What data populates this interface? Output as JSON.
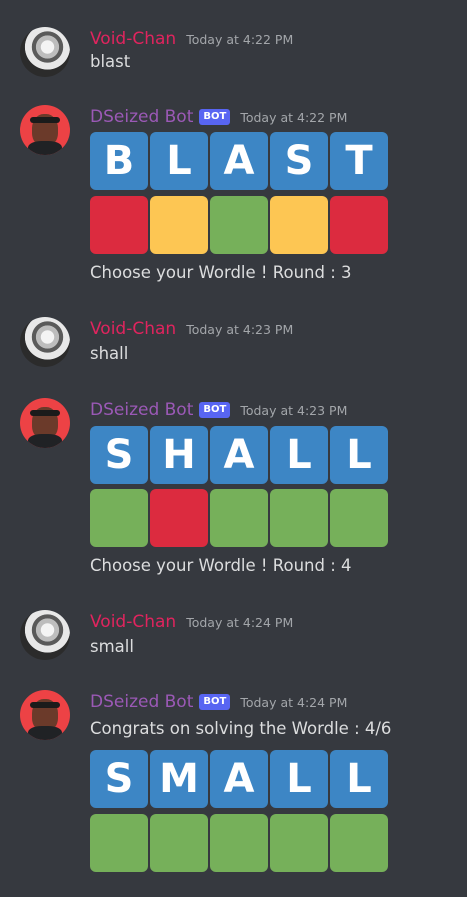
{
  "colors": {
    "letter_tile": "#3d86c5",
    "red": "#dc2b3f",
    "yellow": "#fdc653",
    "green": "#76b05a",
    "user_name": "#e0245e",
    "bot_name": "#9b59b6",
    "bot_tag": "#5865f2",
    "background": "#36393f"
  },
  "messages": [
    {
      "author": "Void-Chan",
      "is_bot": false,
      "time": "Today at 4:22 PM",
      "text": "blast"
    },
    {
      "author": "DSeized Bot",
      "is_bot": true,
      "bot_tag": "BOT",
      "time": "Today at 4:22 PM",
      "letters": [
        "B",
        "L",
        "A",
        "S",
        "T"
      ],
      "result": [
        "red",
        "yellow",
        "green",
        "yellow",
        "red"
      ],
      "text": "Choose your Wordle ! Round : 3"
    },
    {
      "author": "Void-Chan",
      "is_bot": false,
      "time": "Today at 4:23 PM",
      "text": "shall"
    },
    {
      "author": "DSeized Bot",
      "is_bot": true,
      "bot_tag": "BOT",
      "time": "Today at 4:23 PM",
      "letters": [
        "S",
        "H",
        "A",
        "L",
        "L"
      ],
      "result": [
        "green",
        "red",
        "green",
        "green",
        "green"
      ],
      "text": "Choose your Wordle ! Round : 4"
    },
    {
      "author": "Void-Chan",
      "is_bot": false,
      "time": "Today at 4:24 PM",
      "text": "small"
    },
    {
      "author": "DSeized Bot",
      "is_bot": true,
      "bot_tag": "BOT",
      "time": "Today at 4:24 PM",
      "text": "Congrats on solving the Wordle : 4/6",
      "letters": [
        "S",
        "M",
        "A",
        "L",
        "L"
      ],
      "result": [
        "green",
        "green",
        "green",
        "green",
        "green"
      ]
    }
  ]
}
